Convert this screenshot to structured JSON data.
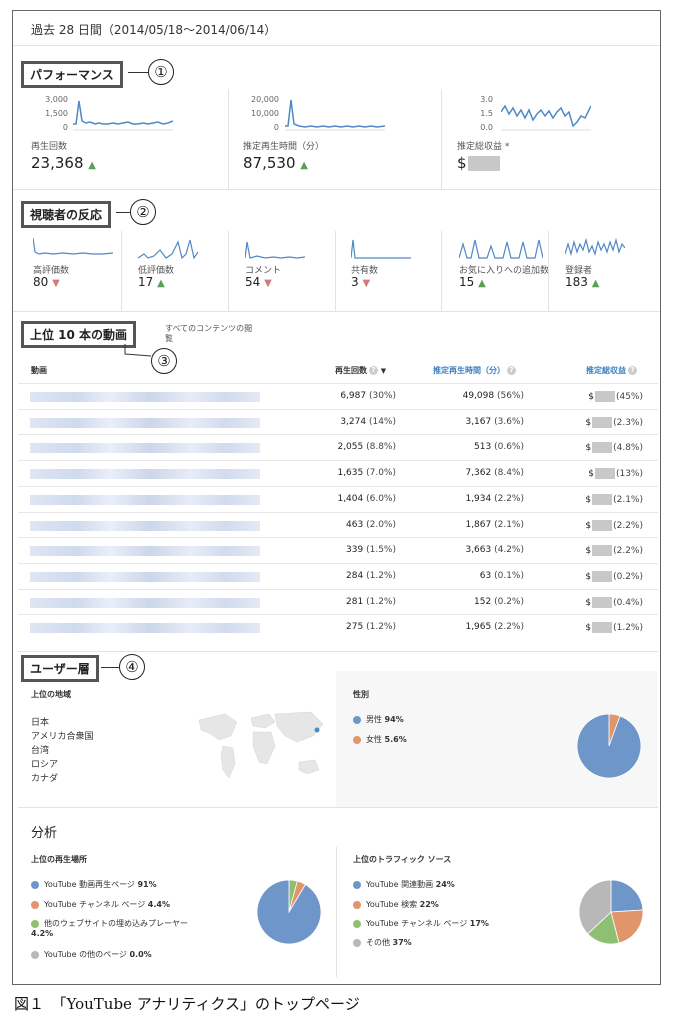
{
  "period": "過去 28 日間（2014/05/18〜2014/06/14）",
  "sections": {
    "performance": "パフォーマンス",
    "reaction": "視聴者の反応",
    "top_videos": "上位 10 本の動画",
    "demographics": "ユーザー層",
    "analysis": "分析"
  },
  "callouts": [
    "①",
    "②",
    "③",
    "④"
  ],
  "performance": {
    "metrics": [
      {
        "ticks": [
          "3,000",
          "1,500",
          "0"
        ],
        "label": "再生回数",
        "value": "23,368",
        "trend": "up"
      },
      {
        "ticks": [
          "20,000",
          "10,000",
          "0"
        ],
        "label": "推定再生時間（分）",
        "value": "87,530",
        "trend": "up"
      },
      {
        "ticks": [
          "3.0",
          "1.5",
          "0.0"
        ],
        "label": "推定総収益 *",
        "value": "$",
        "trend": "none"
      }
    ]
  },
  "reaction": {
    "metrics": [
      {
        "label": "高評価数",
        "value": "80",
        "trend": "down"
      },
      {
        "label": "低評価数",
        "value": "17",
        "trend": "up"
      },
      {
        "label": "コメント",
        "value": "54",
        "trend": "down"
      },
      {
        "label": "共有数",
        "value": "3",
        "trend": "down"
      },
      {
        "label": "お気に入りへの追加数",
        "value": "15",
        "trend": "up"
      },
      {
        "label": "登録者",
        "value": "183",
        "trend": "up"
      }
    ]
  },
  "top_videos": {
    "note": "すべてのコンテンツの閲覧",
    "columns": {
      "video": "動画",
      "views": "再生回数",
      "watch_time": "推定再生時間（分）",
      "revenue": "推定総収益"
    },
    "sort_icon": "▼",
    "rows": [
      {
        "views": "6,987",
        "views_pct": "(30%)",
        "time": "49,098",
        "time_pct": "(56%)",
        "rev": "$",
        "rev_pct": "(45%)"
      },
      {
        "views": "3,274",
        "views_pct": "(14%)",
        "time": "3,167",
        "time_pct": "(3.6%)",
        "rev": "$",
        "rev_pct": "(2.3%)"
      },
      {
        "views": "2,055",
        "views_pct": "(8.8%)",
        "time": "513",
        "time_pct": "(0.6%)",
        "rev": "$",
        "rev_pct": "(4.8%)"
      },
      {
        "views": "1,635",
        "views_pct": "(7.0%)",
        "time": "7,362",
        "time_pct": "(8.4%)",
        "rev": "$",
        "rev_pct": "(13%)"
      },
      {
        "views": "1,404",
        "views_pct": "(6.0%)",
        "time": "1,934",
        "time_pct": "(2.2%)",
        "rev": "$",
        "rev_pct": "(2.1%)"
      },
      {
        "views": "463",
        "views_pct": "(2.0%)",
        "time": "1,867",
        "time_pct": "(2.1%)",
        "rev": "$",
        "rev_pct": "(2.2%)"
      },
      {
        "views": "339",
        "views_pct": "(1.5%)",
        "time": "3,663",
        "time_pct": "(4.2%)",
        "rev": "$",
        "rev_pct": "(2.2%)"
      },
      {
        "views": "284",
        "views_pct": "(1.2%)",
        "time": "63",
        "time_pct": "(0.1%)",
        "rev": "$",
        "rev_pct": "(0.2%)"
      },
      {
        "views": "281",
        "views_pct": "(1.2%)",
        "time": "152",
        "time_pct": "(0.2%)",
        "rev": "$",
        "rev_pct": "(0.4%)"
      },
      {
        "views": "275",
        "views_pct": "(1.2%)",
        "time": "1,965",
        "time_pct": "(2.2%)",
        "rev": "$",
        "rev_pct": "(1.2%)"
      }
    ]
  },
  "demographics": {
    "region_title": "上位の地域",
    "regions": [
      "日本",
      "アメリカ合衆国",
      "台湾",
      "ロシア",
      "カナダ"
    ],
    "gender_title": "性別",
    "gender": [
      {
        "label": "男性",
        "value": "94%",
        "share": 94.4,
        "color": "#6f96c9"
      },
      {
        "label": "女性",
        "value": "5.6%",
        "share": 5.6,
        "color": "#e0956a"
      }
    ]
  },
  "analysis": {
    "playback_title": "上位の再生場所",
    "playback": [
      {
        "label": "YouTube 動画再生ページ",
        "value": "91%",
        "share": 91.4,
        "color": "#6f96c9"
      },
      {
        "label": "YouTube チャンネル ページ",
        "value": "4.4%",
        "share": 4.4,
        "color": "#e0956a"
      },
      {
        "label": "他のウェブサイトの埋め込みプレーヤー",
        "value": "4.2%",
        "share": 4.2,
        "color": "#8fbf72"
      },
      {
        "label": "YouTube の他のページ",
        "value": "0.0%",
        "share": 0.0,
        "color": "#b8b8b8"
      }
    ],
    "traffic_title": "上位のトラフィック ソース",
    "traffic": [
      {
        "label": "YouTube 関連動画",
        "value": "24%",
        "share": 24,
        "color": "#6f96c9"
      },
      {
        "label": "YouTube 検索",
        "value": "22%",
        "share": 22,
        "color": "#e0956a"
      },
      {
        "label": "YouTube チャンネル ページ",
        "value": "17%",
        "share": 17,
        "color": "#8fbf72"
      },
      {
        "label": "その他",
        "value": "37%",
        "share": 37,
        "color": "#b8b8b8"
      }
    ]
  },
  "caption": "図１　「YouTube アナリティクス」のトップページ",
  "colors": {
    "line": "#4f88c6",
    "up": "#5a9f5a",
    "down": "#d27b7b",
    "male": "#6f96c9",
    "female": "#e0956a"
  }
}
